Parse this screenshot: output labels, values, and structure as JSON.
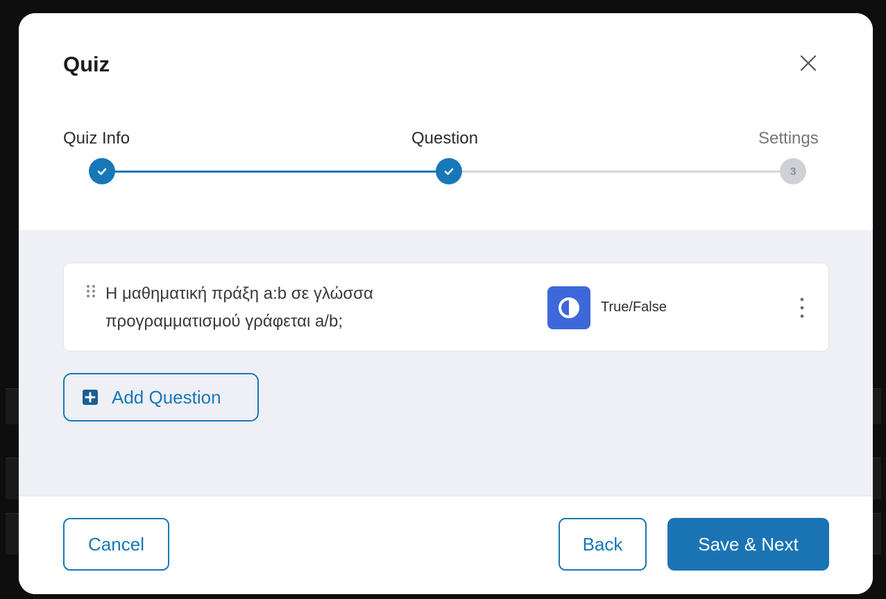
{
  "modal": {
    "title": "Quiz",
    "close_icon": "close-icon"
  },
  "stepper": {
    "steps": [
      {
        "label": "Quiz Info",
        "status": "complete"
      },
      {
        "label": "Question",
        "status": "complete"
      },
      {
        "label": "Settings",
        "status": "pending",
        "number": "3"
      }
    ]
  },
  "questions": [
    {
      "text": "Η μαθηματική πράξη a:b σε γλώσσα προγραμματισμού γράφεται a/b;",
      "type_label": "True/False",
      "type_icon": "half-circle-icon"
    }
  ],
  "add_question_label": "Add Question",
  "footer": {
    "cancel_label": "Cancel",
    "back_label": "Back",
    "save_label": "Save & Next"
  },
  "colors": {
    "accent": "#1877b8",
    "type_icon_bg": "#3e68d9",
    "body_bg": "#eef0f5"
  }
}
